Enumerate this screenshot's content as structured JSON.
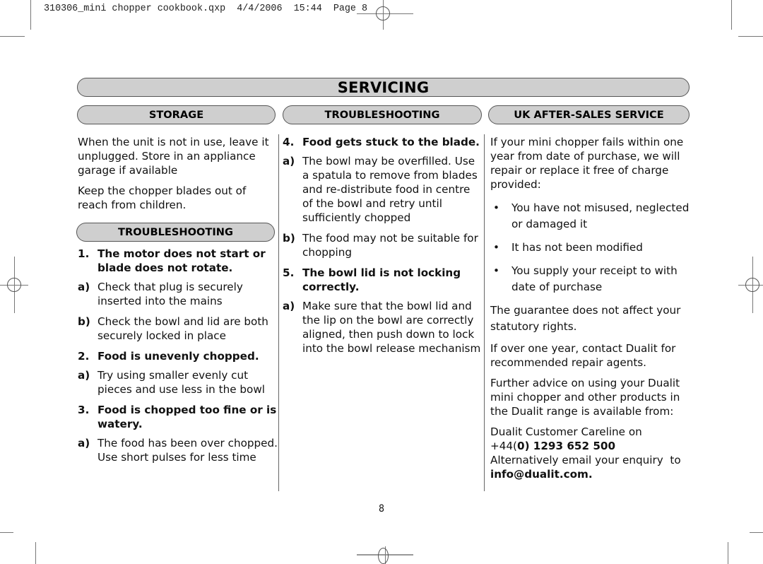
{
  "slug": "310306_mini chopper cookbook.qxp  4/4/2006  15:44  Page 8",
  "title": "SERVICING",
  "columns": {
    "storage": {
      "heading": "STORAGE",
      "paragraphs": [
        "When the unit is not in use, leave it unplugged. Store in an appliance garage if available",
        "Keep the chopper blades out of reach from children."
      ],
      "troubleshooting_heading": "TROUBLESHOOTING",
      "items": [
        {
          "num": "1.",
          "title": "The motor does not start or blade does not rotate.",
          "subs": [
            {
              "label": "a)",
              "text": "Check that plug is securely inserted into the mains"
            },
            {
              "label": "b)",
              "text": "Check the bowl and lid are both securely locked in place"
            }
          ]
        },
        {
          "num": "2.",
          "title": "Food is unevenly chopped.",
          "subs": [
            {
              "label": "a)",
              "text": "Try using smaller evenly cut pieces and use less in the bowl"
            }
          ]
        },
        {
          "num": "3.",
          "title": "Food is chopped too fine or is watery.",
          "subs": [
            {
              "label": "a)",
              "text": "The food has been over chopped. Use short pulses for less time"
            }
          ]
        }
      ]
    },
    "troubleshooting": {
      "heading": "TROUBLESHOOTING",
      "items": [
        {
          "num": "4.",
          "title": "Food gets stuck to the blade.",
          "subs": [
            {
              "label": "a)",
              "text": "The bowl may be overfilled. Use a spatula to remove from blades and re-distribute food in centre of the bowl and retry until sufficiently chopped"
            },
            {
              "label": "b)",
              "text": "The food may not be suitable for chopping"
            }
          ]
        },
        {
          "num": "5.",
          "title": "The bowl lid is not locking correctly.",
          "subs": [
            {
              "label": "a)",
              "text": "Make sure that the bowl lid and the lip on the bowl are correctly aligned, then push down to lock into the bowl release mechanism"
            }
          ]
        }
      ]
    },
    "service": {
      "heading": "UK AFTER-SALES SERVICE",
      "intro": "If your mini chopper fails within one year from date of purchase, we will repair or replace it free of charge provided:",
      "bullet_glyph": "•",
      "bullets": [
        "You have not misused, neglected or damaged it",
        "It has not been modified",
        "You supply your receipt to with date of purchase"
      ],
      "guarantee": "The guarantee does not affect your statutory rights.",
      "over_year": "If over one year, contact Dualit for recommended repair agents.",
      "further": "Further advice on using your Dualit mini chopper and other products in the Dualit range is available from:",
      "careline_label": "Dualit Customer Careline on",
      "phone_prefix": "+44(",
      "phone_zero": "0",
      "phone_rest": ") 1293 652 500",
      "email_label": "Alternatively email your enquiry  to",
      "email": "info@dualit.com."
    }
  },
  "page_number": "8"
}
